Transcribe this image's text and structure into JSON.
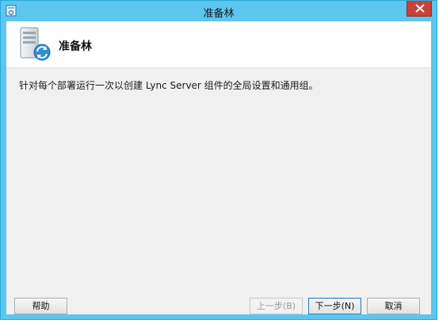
{
  "window": {
    "title": "准备林",
    "icon": "setup-app-icon",
    "close_icon": "close-icon"
  },
  "header": {
    "title": "准备林",
    "icon": "server-sync-icon"
  },
  "content": {
    "description": "针对每个部署运行一次以创建 Lync Server 组件的全局设置和通用组。"
  },
  "buttons": {
    "help": "帮助",
    "back": "上一步(B)",
    "next": "下一步(N)",
    "cancel": "取消"
  },
  "colors": {
    "titlebar": "#5cc6ef",
    "close_button": "#c7423b",
    "client_background": "#f0f0f0"
  }
}
